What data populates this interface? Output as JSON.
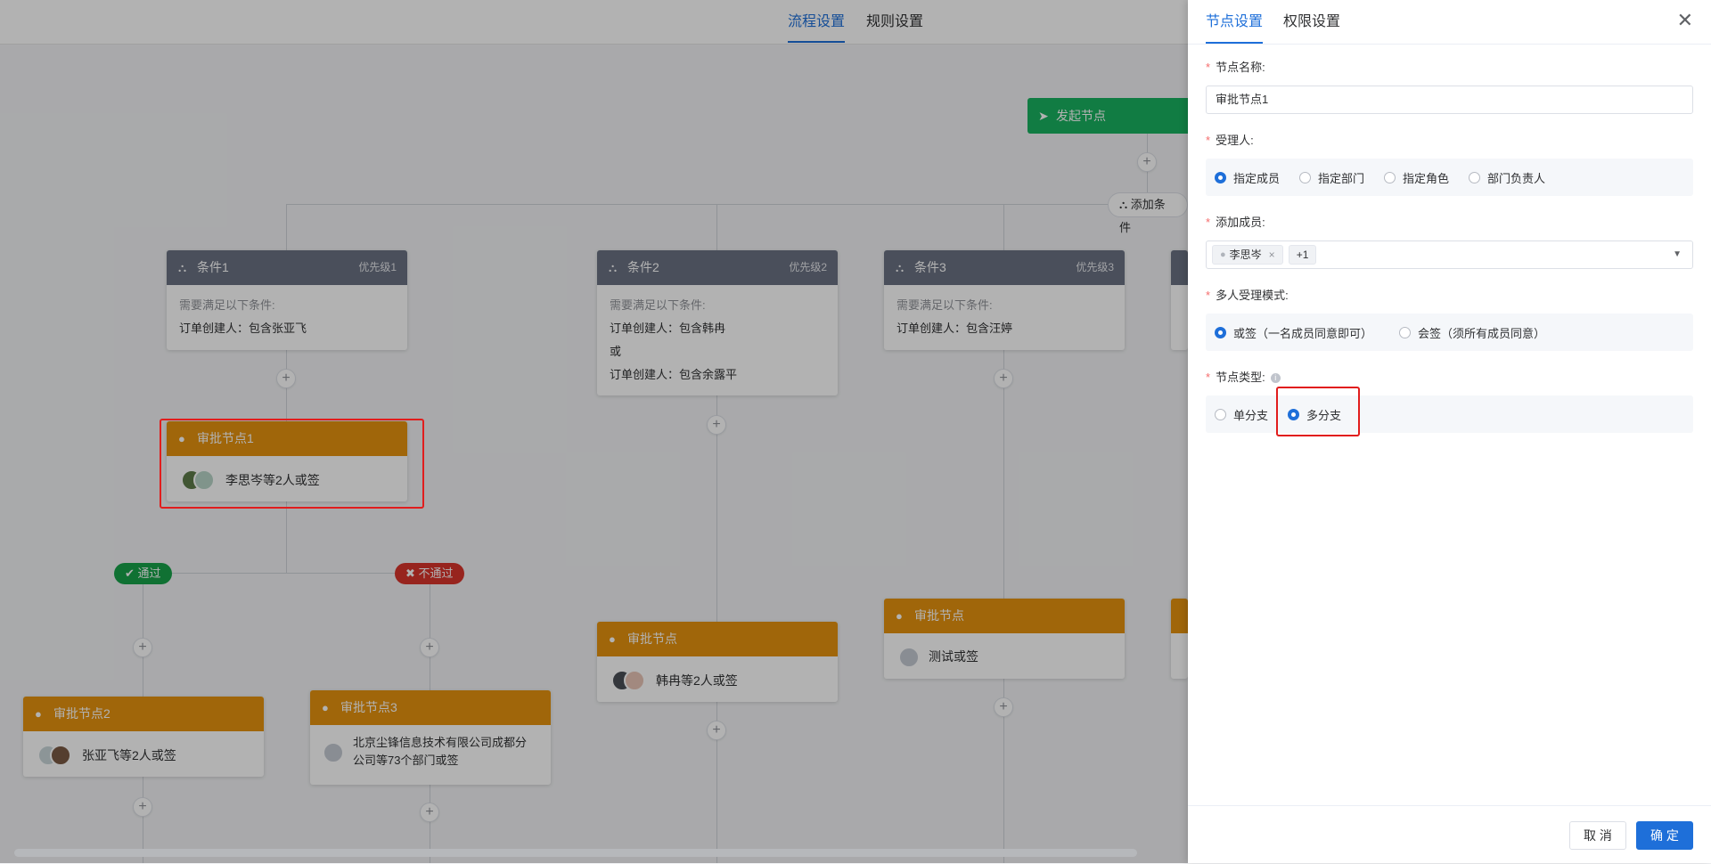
{
  "top_tabs": {
    "flow": "流程设置",
    "rules": "规则设置"
  },
  "flow": {
    "start_node": "发起节点",
    "add_condition": "添加条件",
    "conditions": [
      {
        "title": "条件1",
        "priority": "优先级1",
        "hint": "需要满足以下条件:",
        "lines": [
          "订单创建人：包含张亚飞"
        ]
      },
      {
        "title": "条件2",
        "priority": "优先级2",
        "hint": "需要满足以下条件:",
        "lines": [
          "订单创建人：包含韩冉",
          "或",
          "订单创建人：包含余露平"
        ]
      },
      {
        "title": "条件3",
        "priority": "优先级3",
        "hint": "需要满足以下条件:",
        "lines": [
          "订单创建人：包含汪婷"
        ]
      }
    ],
    "approval_1": {
      "title": "审批节点1",
      "text": "李思岑等2人或签"
    },
    "pass_label": "通过",
    "reject_label": "不通过",
    "approval_2": {
      "title": "审批节点2",
      "text": "张亚飞等2人或签"
    },
    "approval_3": {
      "title": "审批节点3",
      "text": "北京尘锋信息技术有限公司成都分公司等73个部门或签"
    },
    "approval_col2": {
      "title": "审批节点",
      "text": "韩冉等2人或签"
    },
    "approval_col3": {
      "title": "审批节点",
      "text": "测试或签"
    }
  },
  "drawer": {
    "tabs": {
      "node": "节点设置",
      "perm": "权限设置"
    },
    "node_name": {
      "label": "节点名称:",
      "value": "审批节点1"
    },
    "assignee": {
      "label": "受理人:",
      "options": [
        "指定成员",
        "指定部门",
        "指定角色",
        "部门负责人"
      ],
      "selected": "指定成员"
    },
    "members": {
      "label": "添加成员:",
      "tag": "李思岑",
      "more": "+1"
    },
    "mode": {
      "label": "多人受理模式:",
      "options": [
        "或签（一名成员同意即可）",
        "会签（须所有成员同意）"
      ],
      "selected": "或签（一名成员同意即可）"
    },
    "node_type": {
      "label": "节点类型:",
      "options": [
        "单分支",
        "多分支"
      ],
      "selected": "多分支"
    },
    "cancel": "取 消",
    "confirm": "确 定"
  },
  "colors": {
    "primary": "#1e6fd9",
    "condition_header": "#6b7283",
    "approval_header": "#e6930f",
    "start_node": "#19b261",
    "pass": "#17a34a",
    "reject": "#d9342b",
    "highlight": "#e11d1d"
  }
}
